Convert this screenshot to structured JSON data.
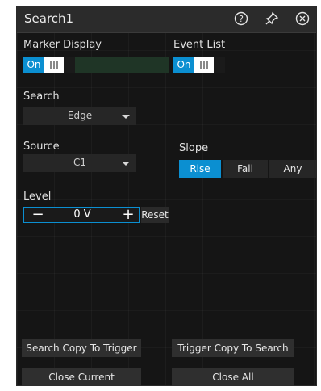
{
  "window": {
    "title": "Search1"
  },
  "titlebar_icons": [
    "help-icon",
    "pin-icon",
    "close-icon"
  ],
  "colors": {
    "accent": "#0b8fd1",
    "panel": "#151515",
    "titlebar": "#2b2b2b"
  },
  "marker_display": {
    "label": "Marker Display",
    "state": "On"
  },
  "event_list": {
    "label": "Event List",
    "state": "On"
  },
  "search": {
    "label": "Search",
    "value": "Edge"
  },
  "source": {
    "label": "Source",
    "value": "C1"
  },
  "slope": {
    "label": "Slope",
    "options": [
      "Rise",
      "Fall",
      "Any"
    ],
    "selected": "Rise"
  },
  "level": {
    "label": "Level",
    "minus": "−",
    "value": "0 V",
    "plus": "+",
    "reset": "Reset"
  },
  "buttons": {
    "search_copy_to_trigger": "Search  Copy To Trigger",
    "trigger_copy_to_search": "Trigger Copy To Search",
    "close_current": "Close Current",
    "close_all": "Close All"
  }
}
